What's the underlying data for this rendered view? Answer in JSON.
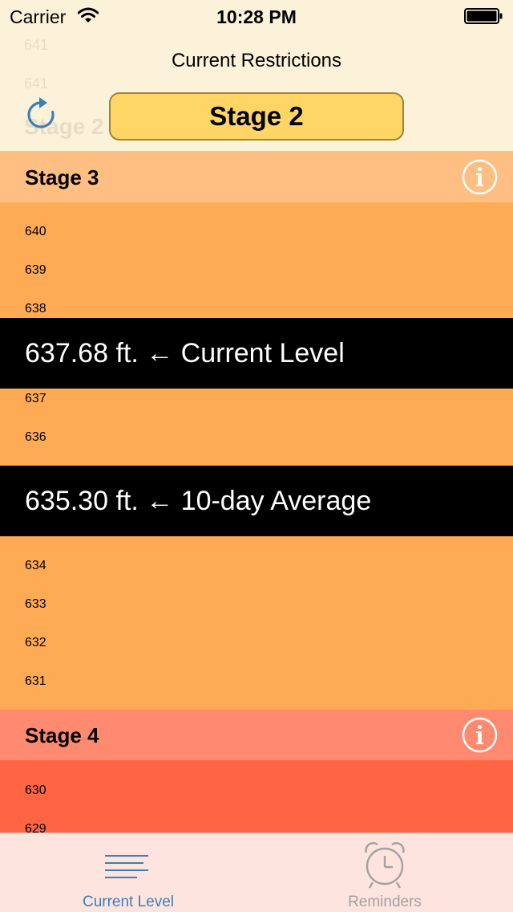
{
  "status_bar": {
    "carrier": "Carrier",
    "time": "10:28 PM"
  },
  "nav": {
    "title": "Current Restrictions",
    "current_stage": "Stage 2"
  },
  "scroll_ghost": {
    "level_a": "641",
    "level_b": "641",
    "stage_label": "Stage 2"
  },
  "stage3": {
    "title": "Stage 3",
    "header_color": "#ffbe82",
    "band_color": "#ffab55",
    "levels_above": [
      "640",
      "639",
      "638"
    ],
    "levels_middle": [
      "637",
      "636"
    ],
    "levels_below": [
      "634",
      "633",
      "632",
      "631"
    ]
  },
  "markers": {
    "current": "637.68 ft. ← Current Level",
    "average": "635.30 ft. ← 10-day Average"
  },
  "stage4": {
    "title": "Stage 4",
    "header_color": "#ff8a70",
    "band_color": "#ff6443",
    "levels": [
      "630",
      "629"
    ]
  },
  "tabs": [
    {
      "label": "Current Level",
      "icon": "list-icon",
      "selected": true
    },
    {
      "label": "Reminders",
      "icon": "alarm-clock-icon",
      "selected": false
    }
  ],
  "colors": {
    "accent": "#3d7fb8",
    "stage_pill": "#ffd666",
    "tab_inactive": "#a6a0a0"
  }
}
